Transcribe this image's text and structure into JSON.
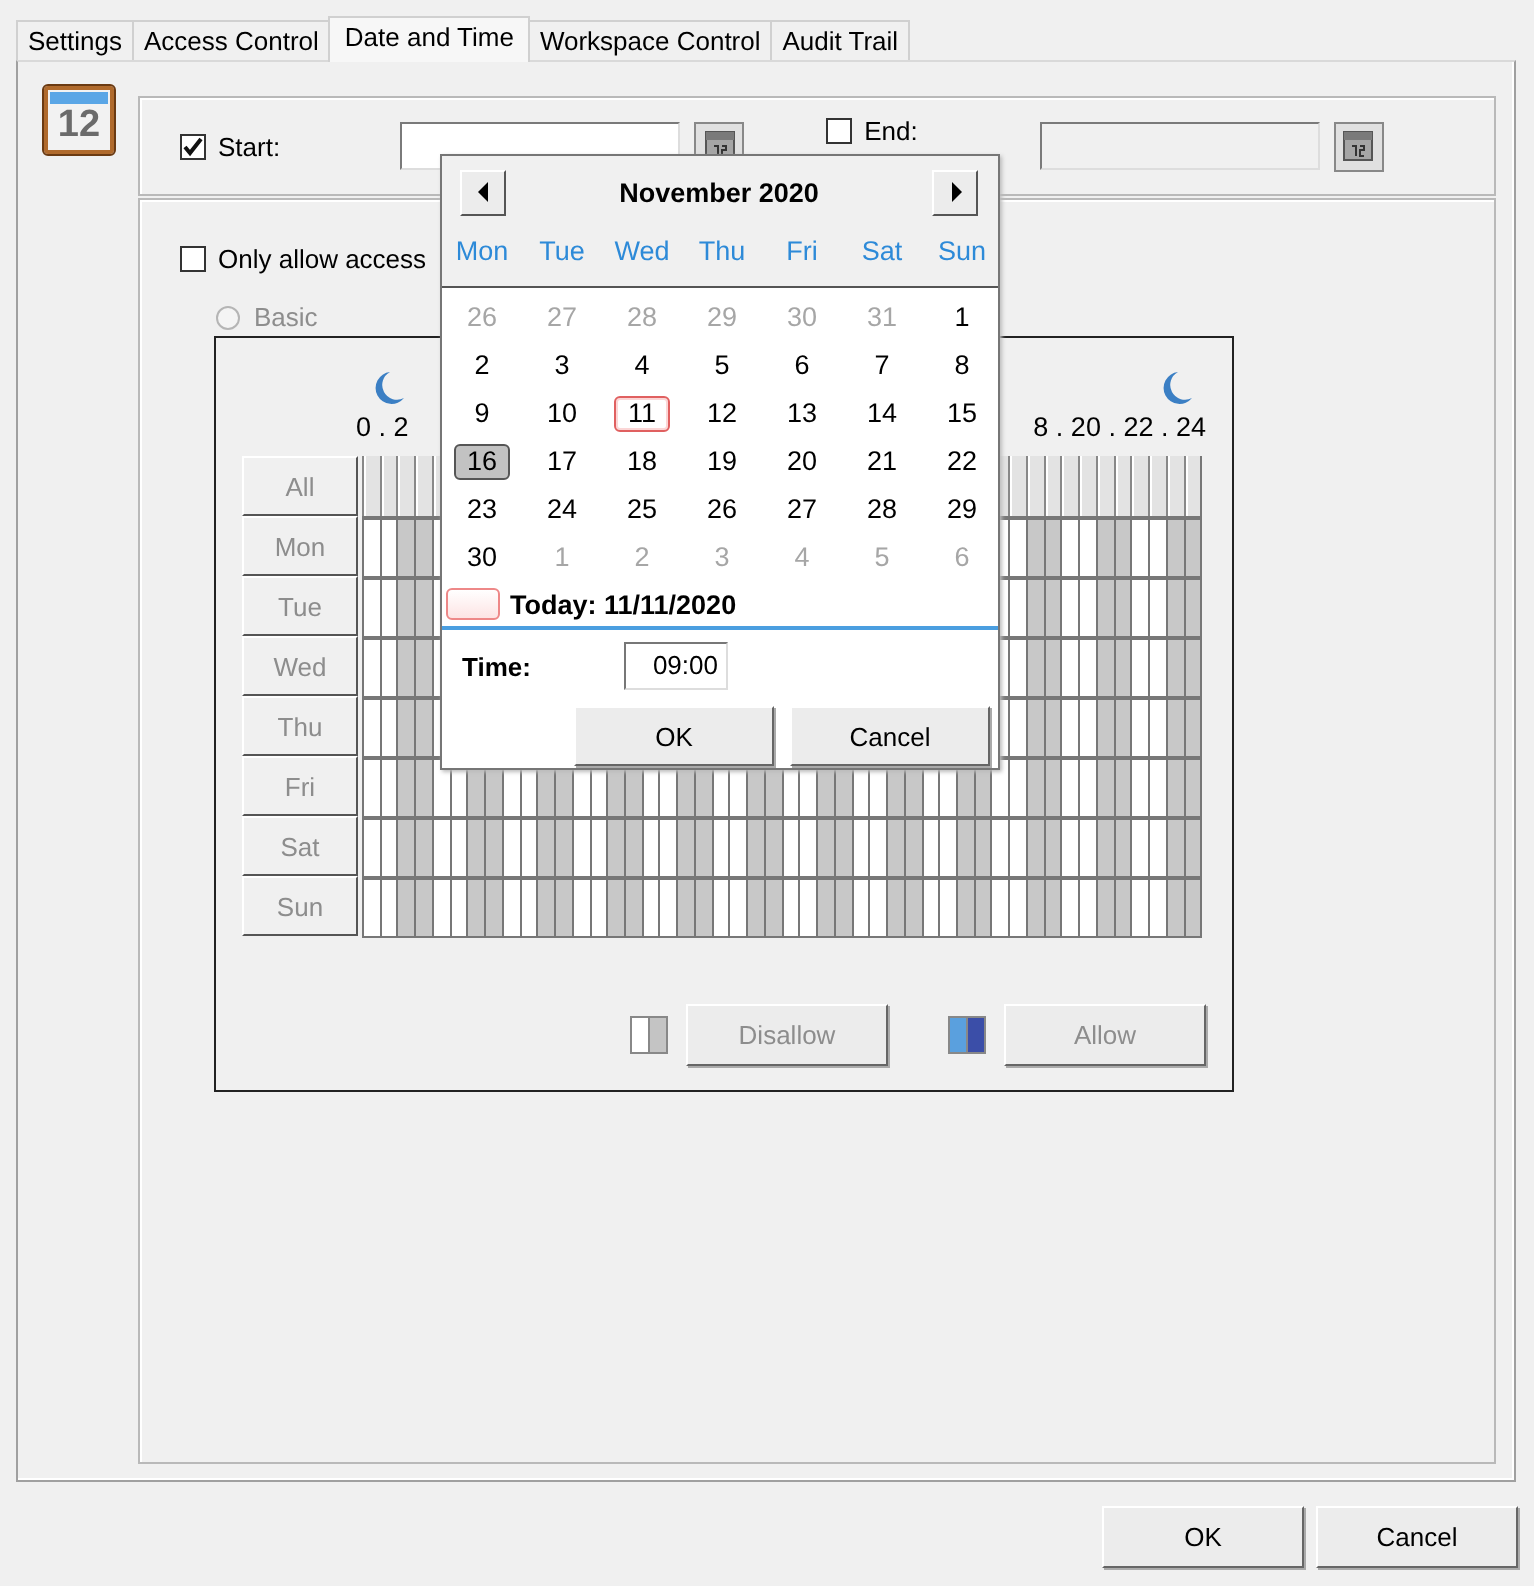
{
  "tabs": [
    {
      "label": "Settings",
      "selected": false
    },
    {
      "label": "Access Control",
      "selected": false
    },
    {
      "label": "Date and Time",
      "selected": true
    },
    {
      "label": "Workspace Control",
      "selected": false
    },
    {
      "label": "Audit Trail",
      "selected": false
    }
  ],
  "page_icon_text": "12",
  "start": {
    "label": "Start:",
    "checked": true
  },
  "end": {
    "label": "End:",
    "checked": false
  },
  "restrict": {
    "label": "Only allow access",
    "checked": false
  },
  "mode_radio": {
    "label": "Basic",
    "selected": false,
    "disabled": true
  },
  "schedule": {
    "hour_labels_left": "0 . 2",
    "hour_labels_right": "8 . 20 . 22 . 24",
    "disabled": true,
    "rows": [
      {
        "label": "All"
      },
      {
        "label": "Mon"
      },
      {
        "label": "Tue"
      },
      {
        "label": "Wed"
      },
      {
        "label": "Thu"
      },
      {
        "label": "Fri"
      },
      {
        "label": "Sat"
      },
      {
        "label": "Sun"
      }
    ]
  },
  "legend": [
    {
      "kind": "disallow",
      "button": "Disallow",
      "disabled": true
    },
    {
      "kind": "allow",
      "button": "Allow",
      "disabled": true
    }
  ],
  "calendar": {
    "month": "November 2020",
    "weekdays": [
      "Mon",
      "Tue",
      "Wed",
      "Thu",
      "Fri",
      "Sat",
      "Sun"
    ],
    "days": [
      {
        "label": "26",
        "other_month": true,
        "today": false,
        "selected": false
      },
      {
        "label": "27",
        "other_month": true,
        "today": false,
        "selected": false
      },
      {
        "label": "28",
        "other_month": true,
        "today": false,
        "selected": false
      },
      {
        "label": "29",
        "other_month": true,
        "today": false,
        "selected": false
      },
      {
        "label": "30",
        "other_month": true,
        "today": false,
        "selected": false
      },
      {
        "label": "31",
        "other_month": true,
        "today": false,
        "selected": false
      },
      {
        "label": "1",
        "other_month": false,
        "today": false,
        "selected": false
      },
      {
        "label": "2",
        "other_month": false,
        "today": false,
        "selected": false
      },
      {
        "label": "3",
        "other_month": false,
        "today": false,
        "selected": false
      },
      {
        "label": "4",
        "other_month": false,
        "today": false,
        "selected": false
      },
      {
        "label": "5",
        "other_month": false,
        "today": false,
        "selected": false
      },
      {
        "label": "6",
        "other_month": false,
        "today": false,
        "selected": false
      },
      {
        "label": "7",
        "other_month": false,
        "today": false,
        "selected": false
      },
      {
        "label": "8",
        "other_month": false,
        "today": false,
        "selected": false
      },
      {
        "label": "9",
        "other_month": false,
        "today": false,
        "selected": false
      },
      {
        "label": "10",
        "other_month": false,
        "today": false,
        "selected": false
      },
      {
        "label": "11",
        "other_month": false,
        "today": true,
        "selected": false
      },
      {
        "label": "12",
        "other_month": false,
        "today": false,
        "selected": false
      },
      {
        "label": "13",
        "other_month": false,
        "today": false,
        "selected": false
      },
      {
        "label": "14",
        "other_month": false,
        "today": false,
        "selected": false
      },
      {
        "label": "15",
        "other_month": false,
        "today": false,
        "selected": false
      },
      {
        "label": "16",
        "other_month": false,
        "today": false,
        "selected": true
      },
      {
        "label": "17",
        "other_month": false,
        "today": false,
        "selected": false
      },
      {
        "label": "18",
        "other_month": false,
        "today": false,
        "selected": false
      },
      {
        "label": "19",
        "other_month": false,
        "today": false,
        "selected": false
      },
      {
        "label": "20",
        "other_month": false,
        "today": false,
        "selected": false
      },
      {
        "label": "21",
        "other_month": false,
        "today": false,
        "selected": false
      },
      {
        "label": "22",
        "other_month": false,
        "today": false,
        "selected": false
      },
      {
        "label": "23",
        "other_month": false,
        "today": false,
        "selected": false
      },
      {
        "label": "24",
        "other_month": false,
        "today": false,
        "selected": false
      },
      {
        "label": "25",
        "other_month": false,
        "today": false,
        "selected": false
      },
      {
        "label": "26",
        "other_month": false,
        "today": false,
        "selected": false
      },
      {
        "label": "27",
        "other_month": false,
        "today": false,
        "selected": false
      },
      {
        "label": "28",
        "other_month": false,
        "today": false,
        "selected": false
      },
      {
        "label": "29",
        "other_month": false,
        "today": false,
        "selected": false
      },
      {
        "label": "30",
        "other_month": false,
        "today": false,
        "selected": false
      },
      {
        "label": "1",
        "other_month": true,
        "today": false,
        "selected": false
      },
      {
        "label": "2",
        "other_month": true,
        "today": false,
        "selected": false
      },
      {
        "label": "3",
        "other_month": true,
        "today": false,
        "selected": false
      },
      {
        "label": "4",
        "other_month": true,
        "today": false,
        "selected": false
      },
      {
        "label": "5",
        "other_month": true,
        "today": false,
        "selected": false
      },
      {
        "label": "6",
        "other_month": true,
        "today": false,
        "selected": false
      }
    ],
    "today_label": "Today: 11/11/2020",
    "time_label": "Time:",
    "time_value": "09:00",
    "buttons": [
      "OK",
      "Cancel"
    ]
  },
  "buttons": [
    "OK",
    "Cancel"
  ]
}
